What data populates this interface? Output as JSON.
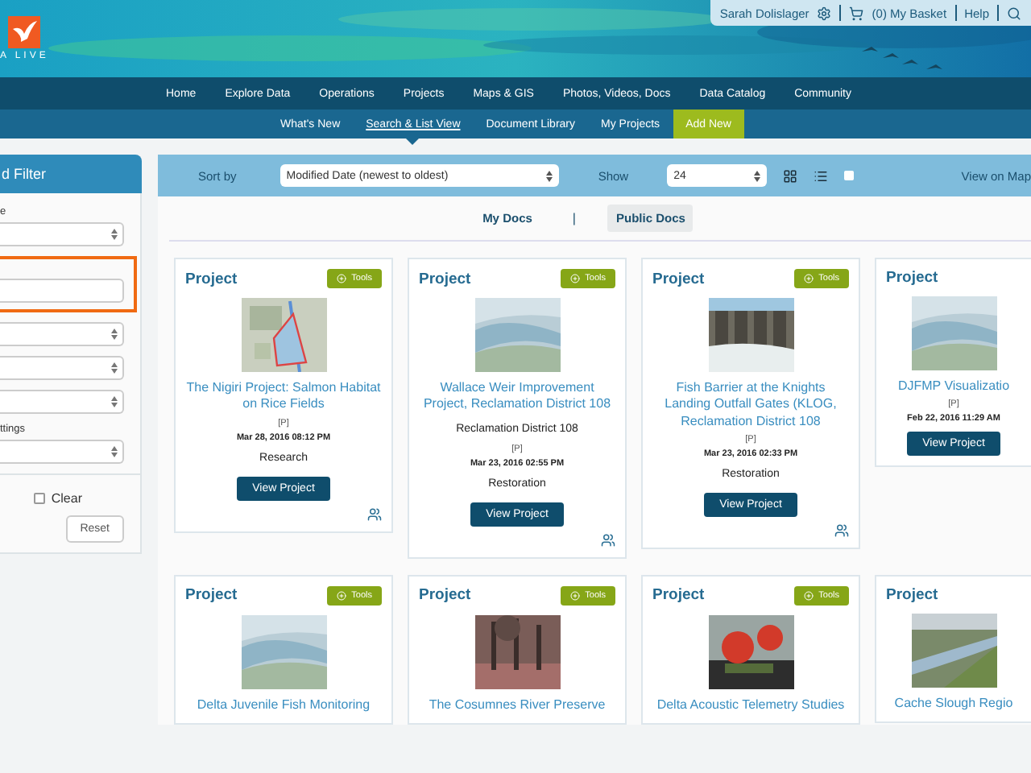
{
  "logo": {
    "text": "A LIVE"
  },
  "user_bar": {
    "user": "Sarah Dolislager",
    "basket": "(0) My Basket",
    "help": "Help"
  },
  "nav": [
    {
      "label": "Home"
    },
    {
      "label": "Explore Data"
    },
    {
      "label": "Operations"
    },
    {
      "label": "Projects"
    },
    {
      "label": "Maps & GIS"
    },
    {
      "label": "Photos, Videos, Docs"
    },
    {
      "label": "Data Catalog"
    },
    {
      "label": "Community"
    }
  ],
  "subnav": [
    {
      "label": "What's New",
      "kind": "link",
      "selected": false
    },
    {
      "label": "Search & List View",
      "kind": "link",
      "selected": true
    },
    {
      "label": "Document Library",
      "kind": "link",
      "selected": false
    },
    {
      "label": "My Projects",
      "kind": "link",
      "selected": false
    },
    {
      "label": "Add New",
      "kind": "action",
      "selected": false
    }
  ],
  "sidebar": {
    "title": "d Filter",
    "fields": [
      {
        "label": "e",
        "kind": "select"
      },
      {
        "kind": "input",
        "highlighted": true
      },
      {
        "kind": "select"
      },
      {
        "kind": "select"
      },
      {
        "kind": "select"
      },
      {
        "label": "ttings",
        "kind": "select"
      }
    ],
    "clear": {
      "label": "Clear",
      "checked": false
    },
    "reset": "Reset"
  },
  "toolbar": {
    "sort_label": "Sort by",
    "sort_value": "Modified Date (newest to oldest)",
    "show_label": "Show",
    "show_value": "24",
    "map_link": "View on Map",
    "view_checkbox": false
  },
  "doc_tabs": [
    {
      "label": "My Docs",
      "selected": false
    },
    {
      "label": "|",
      "kind": "separator"
    },
    {
      "label": "Public Docs",
      "selected": true
    }
  ],
  "cards": [
    {
      "type": "Project",
      "tools": "Tools",
      "title": "The Nigiri Project: Salmon Habitat on Rice Fields",
      "mark": "[P]",
      "date": "Mar 28, 2016 08:12 PM",
      "category": "Research",
      "button": "View Project"
    },
    {
      "type": "Project",
      "tools": "Tools",
      "title": "Wallace Weir Improvement Project, Reclamation District 108",
      "district": "Reclamation District 108",
      "mark": "[P]",
      "date": "Mar 23, 2016 02:55 PM",
      "category": "Restoration",
      "button": "View Project"
    },
    {
      "type": "Project",
      "tools": "Tools",
      "title": "Fish Barrier at the Knights Landing Outfall Gates (KLOG, Reclamation District 108",
      "mark": "[P]",
      "date": "Mar 23, 2016 02:33 PM",
      "category": "Restoration",
      "button": "View Project"
    },
    {
      "type": "Project",
      "title": "DJFMP Visualizatio",
      "mark": "[P]",
      "date": "Feb 22, 2016 11:29 AM",
      "button": "View Project"
    },
    {
      "type": "Project",
      "tools": "Tools",
      "title": "Delta Juvenile Fish Monitoring"
    },
    {
      "type": "Project",
      "tools": "Tools",
      "title": "The Cosumnes River Preserve"
    },
    {
      "type": "Project",
      "tools": "Tools",
      "title": "Delta Acoustic Telemetry Studies"
    },
    {
      "type": "Project",
      "title": "Cache Slough Regio"
    }
  ]
}
